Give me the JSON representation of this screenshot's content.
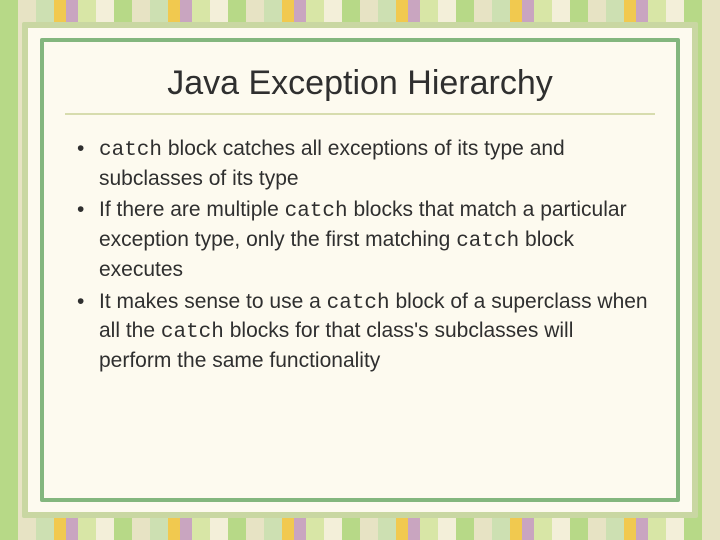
{
  "slide": {
    "title": "Java Exception Hierarchy",
    "bullets": [
      {
        "segments": [
          {
            "text": "catch",
            "style": "code"
          },
          {
            "text": " block catches all exceptions of its type and subclasses of its type",
            "style": "plain"
          }
        ]
      },
      {
        "segments": [
          {
            "text": "If there are multiple ",
            "style": "plain"
          },
          {
            "text": "catch",
            "style": "code"
          },
          {
            "text": " blocks that match a particular exception type, only the first matching ",
            "style": "plain"
          },
          {
            "text": "catch",
            "style": "code"
          },
          {
            "text": " block executes",
            "style": "plain"
          }
        ]
      },
      {
        "segments": [
          {
            "text": "It makes sense to use a ",
            "style": "plain"
          },
          {
            "text": "catch",
            "style": "code"
          },
          {
            "text": " block of a superclass when all the ",
            "style": "plain"
          },
          {
            "text": "catch",
            "style": "code"
          },
          {
            "text": " blocks for that class's subclasses will perform the same functionality",
            "style": "plain"
          }
        ]
      }
    ]
  }
}
